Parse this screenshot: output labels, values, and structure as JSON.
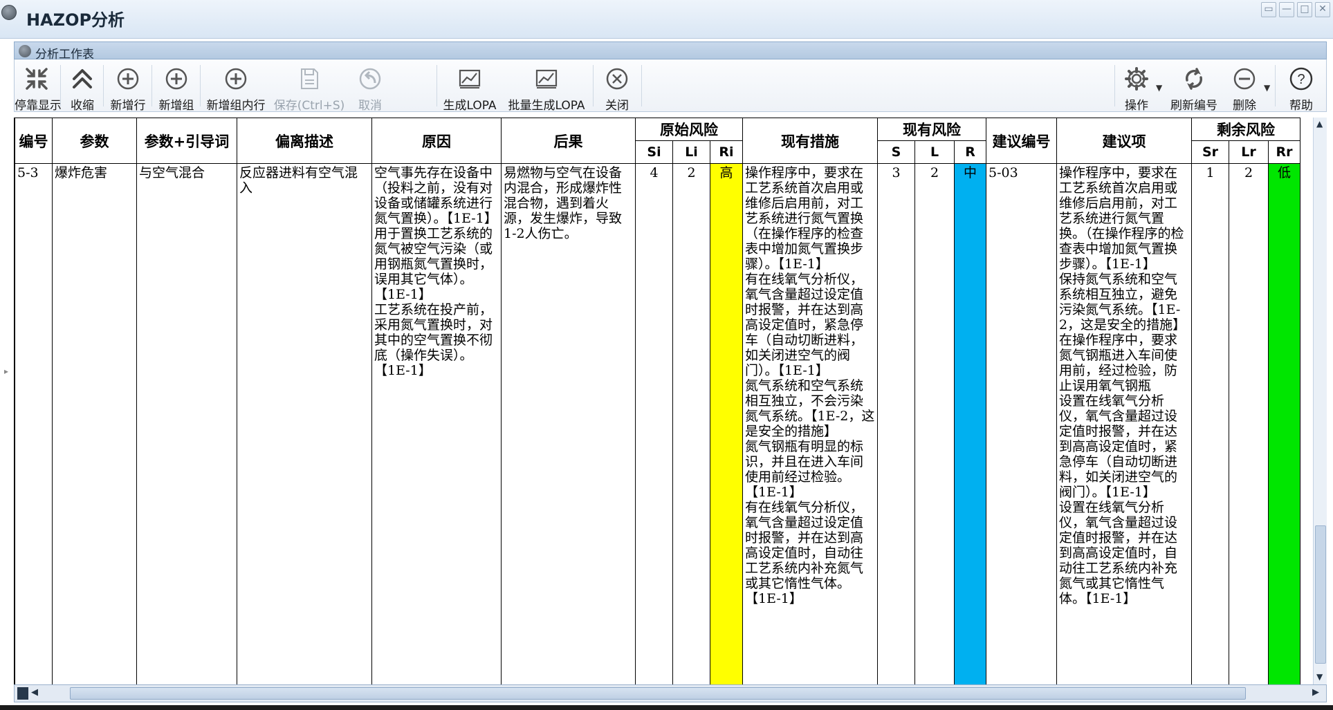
{
  "window": {
    "title": "HAZOP分析",
    "controls": [
      "▭",
      "—",
      "□",
      "✕"
    ]
  },
  "panel": {
    "title": "分析工作表"
  },
  "toolbar": {
    "left": [
      {
        "label": "停靠显示",
        "icon": "dock-icon",
        "enabled": true
      },
      {
        "label": "收缩",
        "icon": "collapse-icon",
        "enabled": true
      },
      {
        "label": "新增行",
        "icon": "add-row-icon",
        "enabled": true
      },
      {
        "label": "新增组",
        "icon": "add-group-icon",
        "enabled": true
      },
      {
        "label": "新增组内行",
        "icon": "add-group-row-icon",
        "enabled": true
      },
      {
        "label": "保存(Ctrl+S)",
        "icon": "save-icon",
        "enabled": false
      },
      {
        "label": "取消",
        "icon": "undo-icon",
        "enabled": false
      },
      {
        "label": "生成LOPA",
        "icon": "chart-icon",
        "enabled": true
      },
      {
        "label": "批量生成LOPA",
        "icon": "chart-icon",
        "enabled": true
      },
      {
        "label": "关闭",
        "icon": "close-icon",
        "enabled": true
      }
    ],
    "right": [
      {
        "label": "操作",
        "icon": "gear-icon",
        "has_dropdown": true
      },
      {
        "label": "刷新编号",
        "icon": "refresh-icon",
        "has_dropdown": false
      },
      {
        "label": "删除",
        "icon": "minus-icon",
        "has_dropdown": true
      },
      {
        "label": "帮助",
        "icon": "help-icon",
        "has_dropdown": false
      }
    ]
  },
  "grid": {
    "headers": {
      "no": "编号",
      "param": "参数",
      "param_guide": "参数+引导词",
      "deviation": "偏离描述",
      "cause": "原因",
      "consequence": "后果",
      "initial_risk": "原始风险",
      "si": "Si",
      "li": "Li",
      "ri": "Ri",
      "measures": "现有措施",
      "current_risk": "现有风险",
      "s": "S",
      "l": "L",
      "r": "R",
      "rec_no": "建议编号",
      "recommendation": "建议项",
      "residual_risk": "剩余风险",
      "sr": "Sr",
      "lr": "Lr",
      "rr": "Rr"
    },
    "rows": [
      {
        "no": "5-3",
        "param": "爆炸危害",
        "param_guide": "与空气混合",
        "deviation": "反应器进料有空气混入",
        "cause": "空气事先存在设备中（投料之前，没有对设备或储罐系统进行氮气置换）。【1E-1】\n用于置换工艺系统的氮气被空气污染（或用钢瓶氮气置换时，误用其它气体）。【1E-1】\n工艺系统在投产前，采用氮气置换时，对其中的空气置换不彻底（操作失误）。【1E-1】",
        "consequence": "易燃物与空气在设备内混合，形成爆炸性混合物，遇到着火源，发生爆炸，导致1-2人伤亡。",
        "si": "4",
        "li": "2",
        "ri": "高",
        "measures": "操作程序中，要求在工艺系统首次启用或维修后启用前，对工艺系统进行氮气置换（在操作程序的检查表中增加氮气置换步骤）。【1E-1】\n有在线氧气分析仪，氧气含量超过设定值时报警，并在达到高高设定值时，紧急停车（自动切断进料，如关闭进空气的阀门）。【1E-1】\n氮气系统和空气系统相互独立，不会污染氮气系统。【1E-2，这是安全的措施】\n氮气钢瓶有明显的标识，并且在进入车间使用前经过检验。【1E-1】\n有在线氧气分析仪，氧气含量超过设定值时报警，并在达到高高设定值时，自动往工艺系统内补充氮气或其它惰性气体。【1E-1】",
        "s": "3",
        "l": "2",
        "r": "中",
        "rec_no": "5-03",
        "recommendation": "操作程序中，要求在工艺系统首次启用或维修后启用前，对工艺系统进行氮气置换。（在操作程序的检查表中增加氮气置换步骤）。【1E-1】\n保持氮气系统和空气系统相互独立，避免污染氮气系统。【1E-2，这是安全的措施】\n在操作程序中，要求氮气钢瓶进入车间使用前，经过检验，防止误用氧气钢瓶\n设置在线氧气分析仪，氧气含量超过设定值时报警，并在达到高高设定值时，紧急停车（自动切断进料，如关闭进空气的阀门）。【1E-1】\n设置在线氧气分析仪，氧气含量超过设定值时报警，并在达到高高设定值时，自动往工艺系统内补充氮气或其它惰性气体。【1E-1】",
        "sr": "1",
        "lr": "2",
        "rr": "低"
      }
    ]
  },
  "colors": {
    "high": "#ffff00",
    "medium": "#00b0f0",
    "low": "#00e600",
    "titlebar": "#d9e6f4"
  }
}
